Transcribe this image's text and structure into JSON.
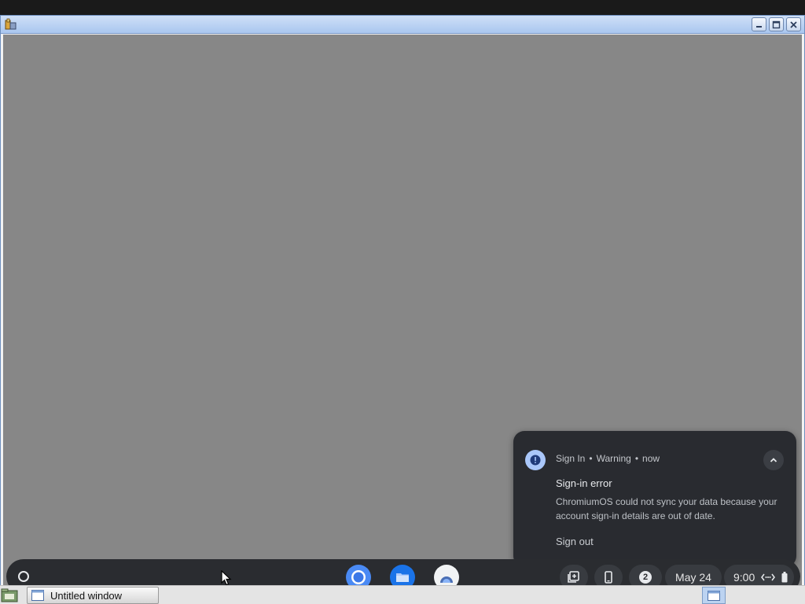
{
  "notification": {
    "source": "Sign In",
    "separator": "•",
    "severity": "Warning",
    "time": "now",
    "title": "Sign-in error",
    "message": "ChromiumOS could not sync your data because your account sign-in details are out of date.",
    "action": "Sign out"
  },
  "shelf": {
    "apps": [
      "chrome-icon",
      "files-icon",
      "camera-app-icon"
    ],
    "tray": {
      "notification_count": "2",
      "date": "May 24",
      "time": "9:00"
    }
  },
  "host_taskbar": {
    "task_label": "Untitled window"
  },
  "colors": {
    "desktop": "#878787",
    "shelf": "#2a2c30",
    "notification_bg": "#292b30",
    "accent": "#aac7fa"
  }
}
